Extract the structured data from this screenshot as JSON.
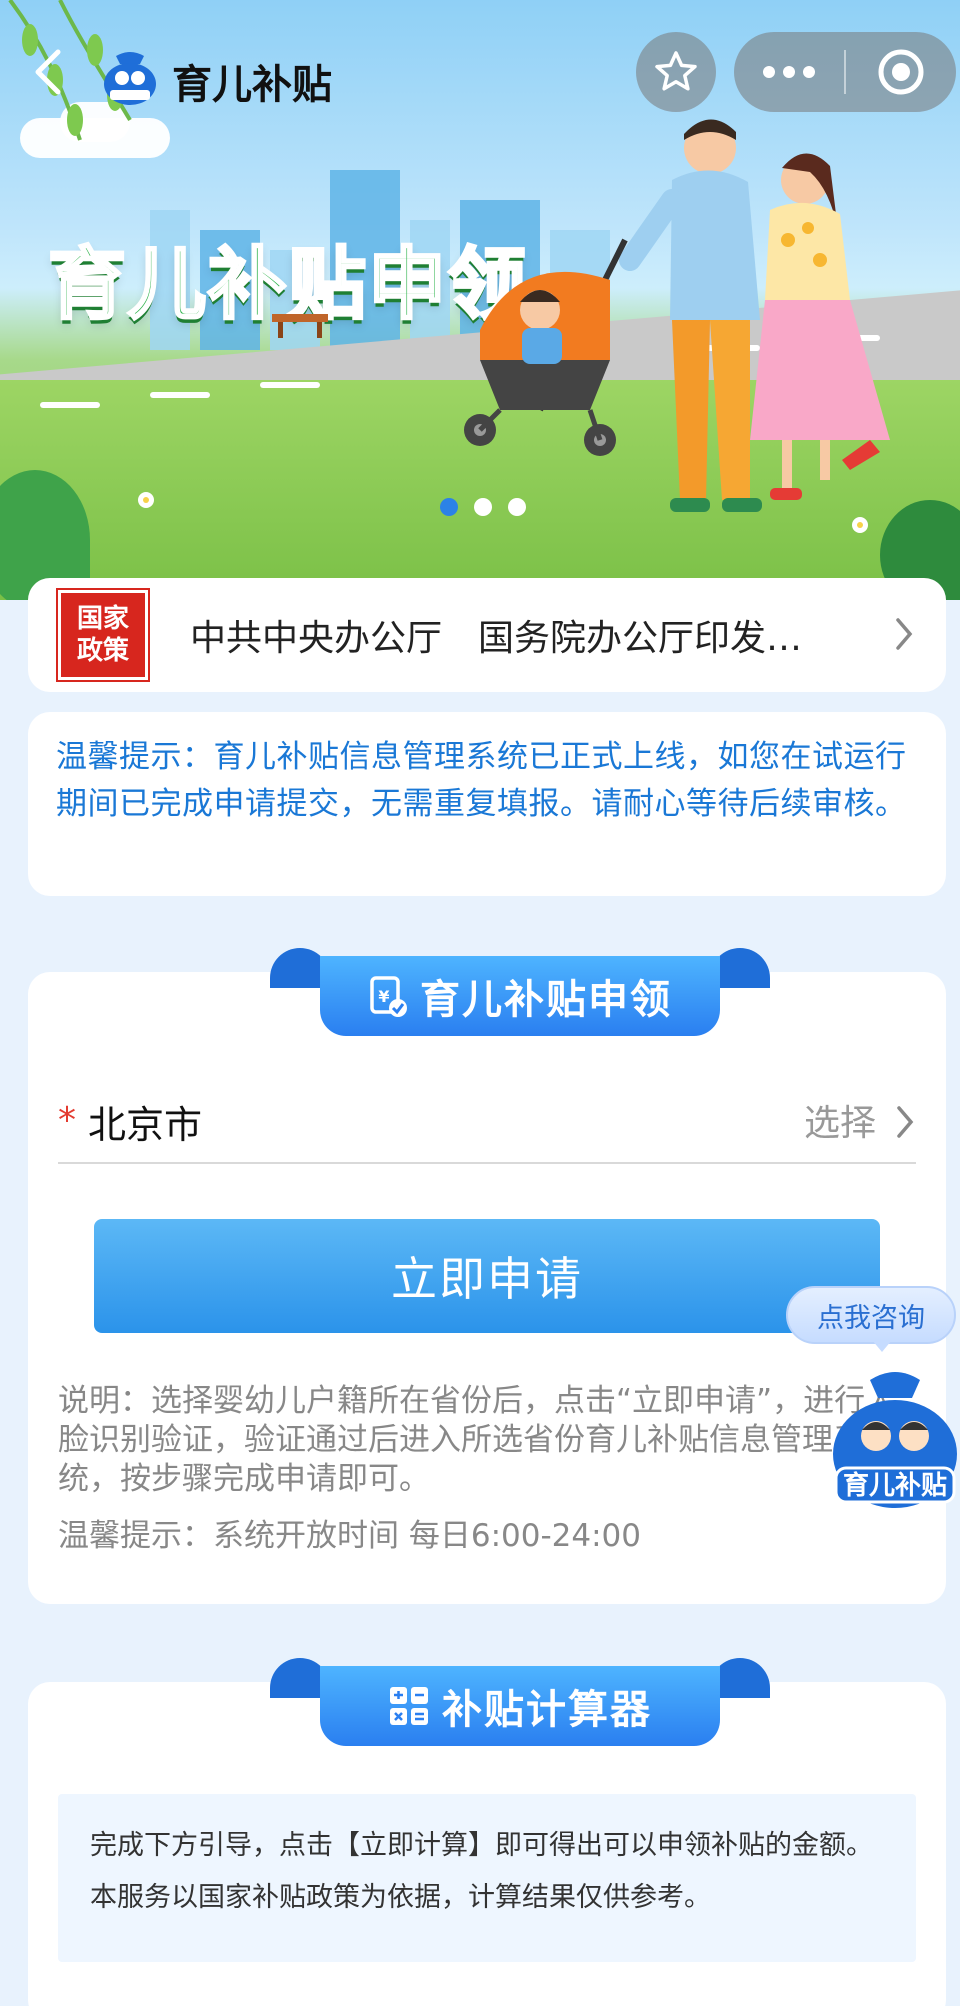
{
  "header": {
    "app_name": "育儿补贴",
    "logo_text": "育儿补贴"
  },
  "hero": {
    "title": "育儿补贴申领",
    "carousel_total": 3,
    "carousel_active": 1
  },
  "policy": {
    "badge_line1": "国家",
    "badge_line2": "政策",
    "text": "中共中央办公厅　国务院办公厅印发…"
  },
  "notice": {
    "text": "温馨提示：育儿补贴信息管理系统已正式上线，如您在试运行期间已完成申请提交，无需重复填报。请耐心等待后续审核。"
  },
  "apply": {
    "section_title": "育儿补贴申领",
    "required_mark": "*",
    "city_value": "北京市",
    "select_label": "选择",
    "button_label": "立即申请",
    "description": "说明：选择婴幼儿户籍所在省份后，点击“立即申请”，进行人脸识别验证，验证通过后进入所选省份育儿补贴信息管理系统，按步骤完成申请即可。",
    "hours": "温馨提示：系统开放时间 每日6:00-24:00"
  },
  "consult": {
    "label": "点我咨询",
    "mascot_label": "育儿补贴"
  },
  "calculator": {
    "section_title": "补贴计算器",
    "description": "完成下方引导，点击【立即计算】即可得出可以申领补贴的金额。本服务以国家补贴政策为依据，计算结果仅供参考。"
  },
  "colors": {
    "accent_blue": "#2b93ea",
    "notice_blue": "#1a78d6",
    "policy_red": "#d7261e",
    "hero_green": "#2fb34c"
  }
}
